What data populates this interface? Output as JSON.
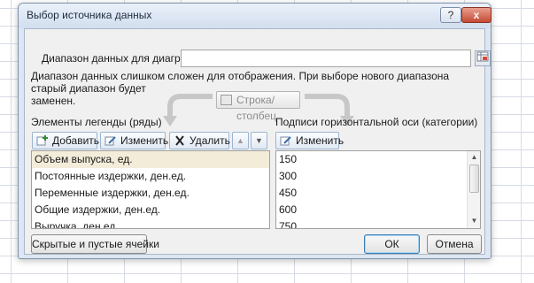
{
  "dialog": {
    "title": "Выбор источника данных",
    "help_label": "?",
    "close_label": "x"
  },
  "range": {
    "label": "Диапазон данных для диаграммы:",
    "value": "",
    "message_line1": "Диапазон данных слишком сложен для отображения. При выборе нового диапазона старый диапазон будет",
    "message_line2": "заменен."
  },
  "switch_button": {
    "label": "Строка/столбец"
  },
  "legend": {
    "title": "Элементы легенды (ряды)",
    "add_label": "Добавить",
    "edit_label": "Изменить",
    "delete_label": "Удалить",
    "up_label": "▲",
    "down_label": "▼",
    "items": [
      "Объем выпуска, ед.",
      "Постоянные издержки, ден.ед.",
      "Переменные издержки, ден.ед.",
      "Общие издержки, ден.ед.",
      "Выручка, ден.ед."
    ]
  },
  "axis": {
    "title": "Подписи горизонтальной оси (категории)",
    "edit_label": "Изменить",
    "items": [
      "150",
      "300",
      "450",
      "600",
      "750"
    ]
  },
  "footer": {
    "hidden_cells_label": "Скрытые и пустые ячейки",
    "ok_label": "ОК",
    "cancel_label": "Отмена"
  },
  "colors": {
    "dialog_bg": "#dde6f2",
    "panel_bg": "#f0f0f0",
    "selected_row": "#f3ecd9"
  }
}
